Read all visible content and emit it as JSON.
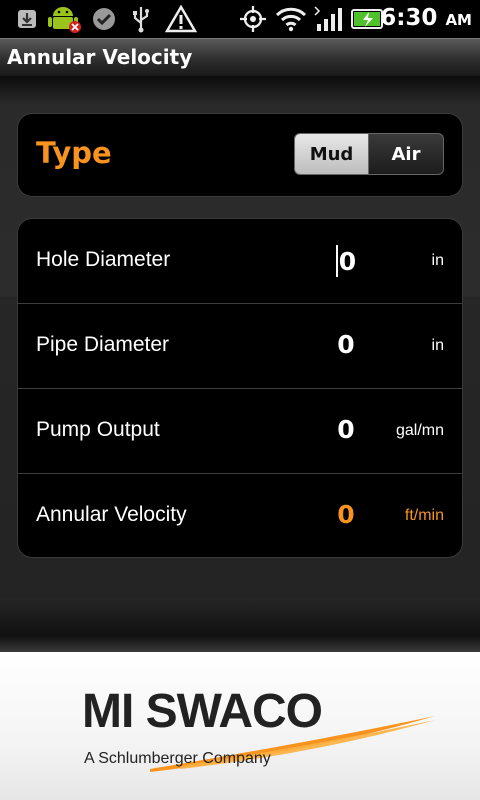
{
  "status_bar": {
    "time": "6:30",
    "ampm": "AM",
    "icons": [
      "download-icon",
      "android-error-icon",
      "check-icon",
      "usb-icon",
      "warning-icon",
      "gps-icon",
      "wifi-icon",
      "signal-icon",
      "battery-charging-icon"
    ]
  },
  "app": {
    "title": "Annular Velocity"
  },
  "type_selector": {
    "label": "Type",
    "options": [
      "Mud",
      "Air"
    ],
    "selected": "Mud"
  },
  "fields": [
    {
      "label": "Hole Diameter",
      "value": "0",
      "unit": "in"
    },
    {
      "label": "Pipe Diameter",
      "value": "0",
      "unit": "in"
    },
    {
      "label": "Pump Output",
      "value": "0",
      "unit": "gal/mn"
    },
    {
      "label": "Annular Velocity",
      "value": "0",
      "unit": "ft/min"
    }
  ],
  "logo": {
    "name": "MI SWACO",
    "tagline": "A Schlumberger Company"
  },
  "colors": {
    "accent": "#f7931e",
    "panel": "#000000",
    "background": "#2a2a2a"
  }
}
